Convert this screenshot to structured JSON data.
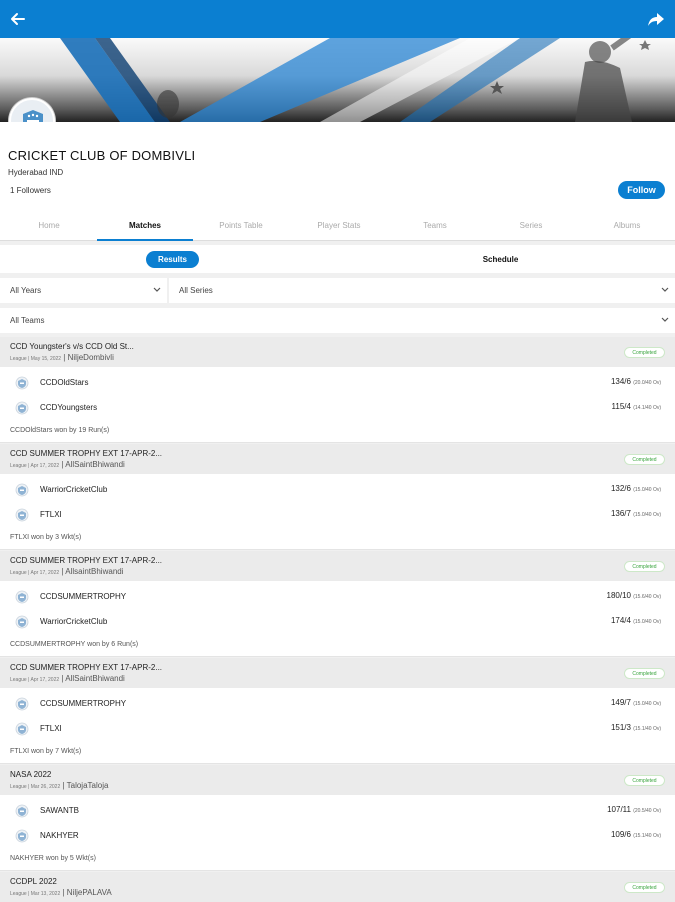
{
  "app": {
    "back_icon": "back-arrow-icon",
    "share_icon": "share-icon",
    "accent_color": "#0b7fd1"
  },
  "club": {
    "name": "CRICKET CLUB OF DOMBIVLI",
    "location": "Hyderabad IND",
    "followers": "1 Followers",
    "follow_label": "Follow"
  },
  "tabs": [
    "Home",
    "Matches",
    "Points Table",
    "Player Stats",
    "Teams",
    "Series",
    "Albums"
  ],
  "segments": {
    "results": "Results",
    "schedule": "Schedule"
  },
  "filters": {
    "years": "All Years",
    "series": "All Series",
    "teams": "All Teams"
  },
  "matches": [
    {
      "title": "CCD Youngster's v/s CCD Old St...",
      "type": "League",
      "date": "May 15, 2022",
      "venue": "NiljeDombivli",
      "status": "Completed",
      "teams": [
        {
          "name": "CCDOldStars",
          "score": "134/6",
          "overs": "(20.0/40 Ov)"
        },
        {
          "name": "CCDYoungsters",
          "score": "115/4",
          "overs": "(14.1/40 Ov)"
        }
      ],
      "result": "CCDOldStars won by 19 Run(s)"
    },
    {
      "title": "CCD SUMMER TROPHY EXT 17-APR-2...",
      "type": "League",
      "date": "Apr 17, 2022",
      "venue": "AllSaintBhiwandi",
      "status": "Completed",
      "teams": [
        {
          "name": "WarriorCricketClub",
          "score": "132/6",
          "overs": "(15.0/40 Ov)"
        },
        {
          "name": "FTLXI",
          "score": "136/7",
          "overs": "(15.0/40 Ov)"
        }
      ],
      "result": "FTLXI won by 3 Wkt(s)"
    },
    {
      "title": "CCD SUMMER TROPHY EXT 17-APR-2...",
      "type": "League",
      "date": "Apr 17, 2022",
      "venue": "AllsaintBhiwandi",
      "status": "Completed",
      "teams": [
        {
          "name": "CCDSUMMERTROPHY",
          "score": "180/10",
          "overs": "(15.6/40 Ov)"
        },
        {
          "name": "WarriorCricketClub",
          "score": "174/4",
          "overs": "(15.0/40 Ov)"
        }
      ],
      "result": "CCDSUMMERTROPHY won by 6 Run(s)"
    },
    {
      "title": "CCD SUMMER TROPHY EXT 17-APR-2...",
      "type": "League",
      "date": "Apr 17, 2022",
      "venue": "AllSaintBhiwandi",
      "status": "Completed",
      "teams": [
        {
          "name": "CCDSUMMERTROPHY",
          "score": "149/7",
          "overs": "(15.0/40 Ov)"
        },
        {
          "name": "FTLXI",
          "score": "151/3",
          "overs": "(15.1/40 Ov)"
        }
      ],
      "result": "FTLXI won by 7 Wkt(s)"
    },
    {
      "title": "NASA 2022",
      "type": "League",
      "date": "Mar 26, 2022",
      "venue": "TalojaTaloja",
      "status": "Completed",
      "teams": [
        {
          "name": "SAWANTB",
          "score": "107/11",
          "overs": "(20.5/40 Ov)"
        },
        {
          "name": "NAKHYER",
          "score": "109/6",
          "overs": "(15.1/40 Ov)"
        }
      ],
      "result": "NAKHYER won by 5 Wkt(s)"
    },
    {
      "title": "CCDPL 2022",
      "type": "League",
      "date": "Mar 13, 2022",
      "venue": "NiljePALAVA",
      "status": "Completed",
      "teams": [],
      "result": ""
    }
  ]
}
